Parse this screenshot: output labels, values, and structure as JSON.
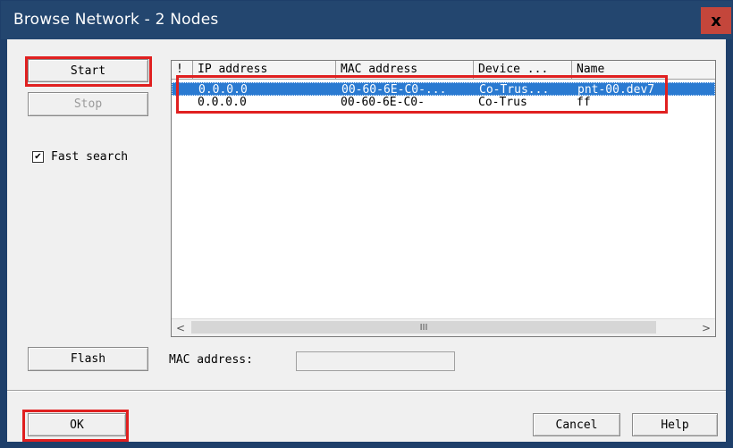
{
  "window": {
    "title": "Browse Network - 2 Nodes",
    "close_label": "x"
  },
  "buttons": {
    "start": "Start",
    "stop": "Stop",
    "flash": "Flash",
    "ok": "OK",
    "cancel": "Cancel",
    "help": "Help"
  },
  "fast_search": {
    "label": "Fast search",
    "checked": true,
    "check_mark": "✔"
  },
  "list": {
    "columns": [
      "!",
      "IP address",
      "MAC address",
      "Device ...",
      "Name"
    ],
    "rows": [
      {
        "flag": "",
        "ip": "0.0.0.0",
        "mac": "00-60-6E-C0-...",
        "device": "Co-Trus...",
        "name": "pnt-00.dev7"
      },
      {
        "flag": "",
        "ip": "0.0.0.0",
        "mac": "00-60-6E-C0-",
        "device": "Co-Trus",
        "name": "ff"
      }
    ],
    "scroll_left": "<",
    "scroll_right": ">",
    "scroll_grip": "III"
  },
  "mac_address": {
    "label": "MAC address:",
    "value": ""
  },
  "colors": {
    "highlight": "#e02020",
    "selection": "#2a7ad1",
    "titlebar": "#23466f"
  }
}
